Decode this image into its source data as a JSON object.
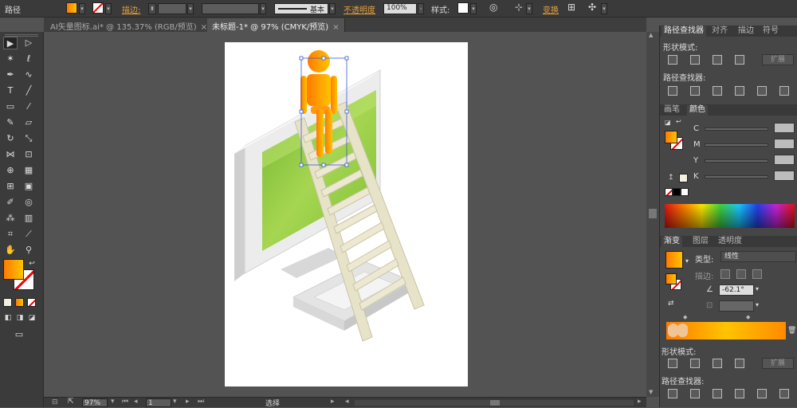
{
  "control_bar": {
    "object_label": "路径",
    "stroke_label": "描边:",
    "profile_label": "基本",
    "opacity_label": "不透明度",
    "opacity_value": "100%",
    "style_label": "样式:",
    "transform_label": "变换"
  },
  "document_tabs": [
    {
      "label": "AI矢量图标.ai* @ 135.37% (RGB/预览)",
      "close": "×"
    },
    {
      "label": "未标题-1* @ 97% (CMYK/预览)",
      "close": "×"
    }
  ],
  "status_bar": {
    "zoom": "97%",
    "artboard_number": "1",
    "status_text": "选择"
  },
  "pathfinder_panel": {
    "tabs": [
      "路径查找器",
      "对齐",
      "描边",
      "符号"
    ],
    "shape_modes_label": "形状模式:",
    "pathfinders_label": "路径查找器:",
    "expand_button": "扩展"
  },
  "color_panel": {
    "tabs": [
      "画笔",
      "颜色"
    ],
    "channels": [
      "C",
      "M",
      "Y",
      "K"
    ]
  },
  "gradient_panel": {
    "tabs": [
      "渐变",
      "图层",
      "透明度"
    ],
    "type_label": "类型:",
    "type_value": "线性",
    "stroke_label": "描边:",
    "angle_value": "-62.1°"
  },
  "pathfinder_panel_2": {
    "shape_modes_label": "形状模式:",
    "pathfinders_label": "路径查找器:",
    "expand_button": "扩展"
  },
  "colors": {
    "fill_gradient_start": "#ff7a00",
    "fill_gradient_end": "#ffc400",
    "screen_green": "#8cc63f",
    "ui_bg": "#535353",
    "panel_bg": "#464646",
    "selection_blue": "#3b5bdb"
  },
  "icons": [
    "selection-icon",
    "direct-selection-icon",
    "magic-wand-icon",
    "lasso-icon",
    "pen-icon",
    "curvature-icon",
    "type-icon",
    "line-icon",
    "rectangle-icon",
    "paintbrush-icon",
    "pencil-icon",
    "eraser-icon",
    "rotate-icon",
    "scale-icon",
    "width-icon",
    "free-transform-icon",
    "shape-builder-icon",
    "perspective-icon",
    "mesh-icon",
    "gradient-icon",
    "eyedropper-icon",
    "blend-icon",
    "symbol-sprayer-icon",
    "graph-icon",
    "artboard-icon",
    "slice-icon",
    "hand-icon",
    "zoom-icon"
  ]
}
